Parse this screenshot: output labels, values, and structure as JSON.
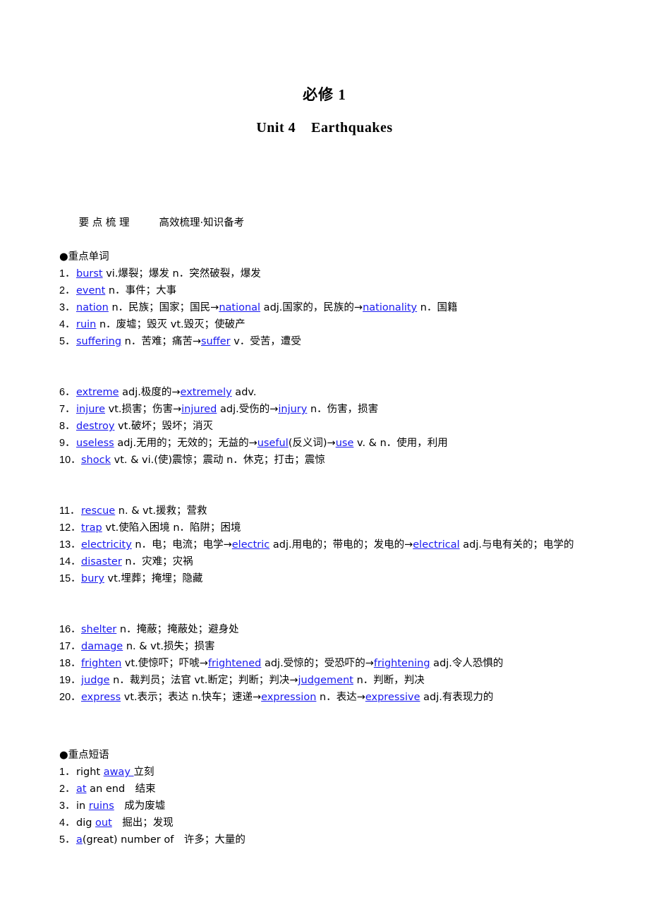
{
  "document": {
    "book_title": "必修 1",
    "unit_title_prefix": "Unit 4",
    "unit_title_name": "Earthquakes"
  },
  "section_header": {
    "label": "要 点 梳 理",
    "subtitle": "高效梳理·知识备考"
  },
  "words_section": {
    "heading": "●重点单词",
    "items": [
      {
        "num": "1．",
        "html": "<span class=\"kw\">burst</span> vi.爆裂；爆发 n．突然破裂，爆发"
      },
      {
        "num": "2．",
        "html": "<span class=\"kw\">event</span> n．事件；大事"
      },
      {
        "num": "3．",
        "html": "<span class=\"kw\">nation</span> n．民族；国家；国民→<span class=\"kw\">national</span> adj.国家的，民族的→<span class=\"kw\">nationality</span> n．国籍"
      },
      {
        "num": "4．",
        "html": "<span class=\"kw\">ruin</span> n．废墟；毁灭 vt.毁灭；使破产"
      },
      {
        "num": "5．",
        "html": "<span class=\"kw\">suffering</span> n．苦难；痛苦→<span class=\"kw\">suffer</span> v．受苦，遭受"
      },
      {
        "num": "6．",
        "html": "<span class=\"kw\">extreme</span> adj.极度的→<span class=\"kw\">extremely</span> adv."
      },
      {
        "num": "7．",
        "html": "<span class=\"kw\">injure</span> vt.损害；伤害→<span class=\"kw\">injured</span> adj.受伤的→<span class=\"kw\">injury</span> n．伤害，损害"
      },
      {
        "num": "8．",
        "html": "<span class=\"kw\">destroy</span> vt.破坏；毁坏；消灭"
      },
      {
        "num": "9．",
        "html": "<span class=\"kw\">useless</span> adj.无用的；无效的；无益的→<span class=\"kw\">useful</span>(反义词)→<span class=\"kw\">use</span> v. &amp; n．使用，利用"
      },
      {
        "num": "10．",
        "html": "<span class=\"kw\">shock</span> vt. &amp; vi.(使)震惊；震动 n．休克；打击；震惊"
      },
      {
        "num": "11．",
        "html": "<span class=\"kw\">rescue</span> n. &amp; vt.援救；营救"
      },
      {
        "num": "12．",
        "html": "<span class=\"kw\">trap</span> vt.使陷入困境 n．陷阱；困境"
      },
      {
        "num": "13．",
        "html": "<span class=\"kw\">electricity</span> n．电；电流；电学→<span class=\"kw\">electric</span> adj.用电的；带电的；发电的→<span class=\"kw\">electrical</span> adj.与电有关的；电学的"
      },
      {
        "num": "14．",
        "html": "<span class=\"kw\">disaster</span> n．灾难；灾祸"
      },
      {
        "num": "15．",
        "html": "<span class=\"kw\">bury</span> vt.埋葬；掩埋；隐藏"
      },
      {
        "num": "16．",
        "html": "<span class=\"kw\">shelter</span> n．掩蔽；掩蔽处；避身处"
      },
      {
        "num": "17．",
        "html": "<span class=\"kw\">damage</span> n. &amp; vt.损失；损害"
      },
      {
        "num": "18．",
        "html": "<span class=\"kw\">frighten</span> vt.使惊吓；吓唬→<span class=\"kw\">frightened</span> adj.受惊的；受恐吓的→<span class=\"kw\">frightening</span> adj.令人恐惧的"
      },
      {
        "num": "19．",
        "html": "<span class=\"kw\">judge</span> n．裁判员；法官 vt.断定；判断；判决→<span class=\"kw\">judgement</span> n．判断，判决"
      },
      {
        "num": "20．",
        "html": "<span class=\"kw\">express</span> vt.表示；表达 n.快车；速递→<span class=\"kw\">expression</span> n．表达→<span class=\"kw\">expressive</span> adj.有表现力的"
      }
    ],
    "plain_items": [
      "burst vi.爆裂；爆发 n．突然破裂，爆发",
      "event n．事件；大事",
      "nation n．民族；国家；国民→national adj.国家的，民族的→nationality n．国籍",
      "ruin n．废墟；毁灭 vt.毁灭；使破产",
      "suffering n．苦难；痛苦→suffer v．受苦，遭受",
      "extreme adj.极度的→extremely adv.",
      "injure vt.损害；伤害→injured adj.受伤的→injury n．伤害，损害",
      "destroy vt.破坏；毁坏；消灭",
      "useless adj.无用的；无效的；无益的→useful(反义词)→use v. & n．使用，利用",
      "shock vt. & vi.(使)震惊；震动 n．休克；打击；震惊",
      "rescue n. & vt.援救；营救",
      "trap vt.使陷入困境 n．陷阱；困境",
      "electricity n．电；电流；电学→electric adj.用电的；带电的；发电的→electrical adj.与电有关的；电学的",
      "disaster n．灾难；灾祸",
      "bury vt.埋葬；掩埋；隐藏",
      "shelter n．掩蔽；掩蔽处；避身处",
      "damage n. & vt.损失；损害",
      "frighten vt.使惊吓；吓唬→frightened adj.受惊的；受恐吓的→frightening adj.令人恐惧的",
      "judge n．裁判员；法官 vt.断定；判断；判决→judgement n．判断，判决",
      "express vt.表示；表达 n.快车；速递→expression n．表达→expressive adj.有表现力的"
    ]
  },
  "phrases_section": {
    "heading": "●重点短语",
    "items": [
      {
        "num": "1．",
        "html": "right <span class=\"kw\">away </span>立刻"
      },
      {
        "num": "2．",
        "html": "<span class=\"kw\">at</span> an end　结束"
      },
      {
        "num": "3．",
        "html": "in <span class=\"kw\">ruins</span>　成为废墟"
      },
      {
        "num": "4．",
        "html": "dig <span class=\"kw\">out</span>　掘出；发现"
      },
      {
        "num": "5．",
        "html": "<span class=\"kw\">a</span>(great) number of　许多；大量的"
      }
    ],
    "plain_items": [
      "right away 立刻",
      "at an end 结束",
      "in ruins 成为废墟",
      "dig out 掘出；发现",
      "a(great) number of 许多；大量的"
    ]
  },
  "colors": {
    "keyword_blue": "#1a1af0",
    "text_black": "#000000",
    "page_background": "#ffffff"
  }
}
